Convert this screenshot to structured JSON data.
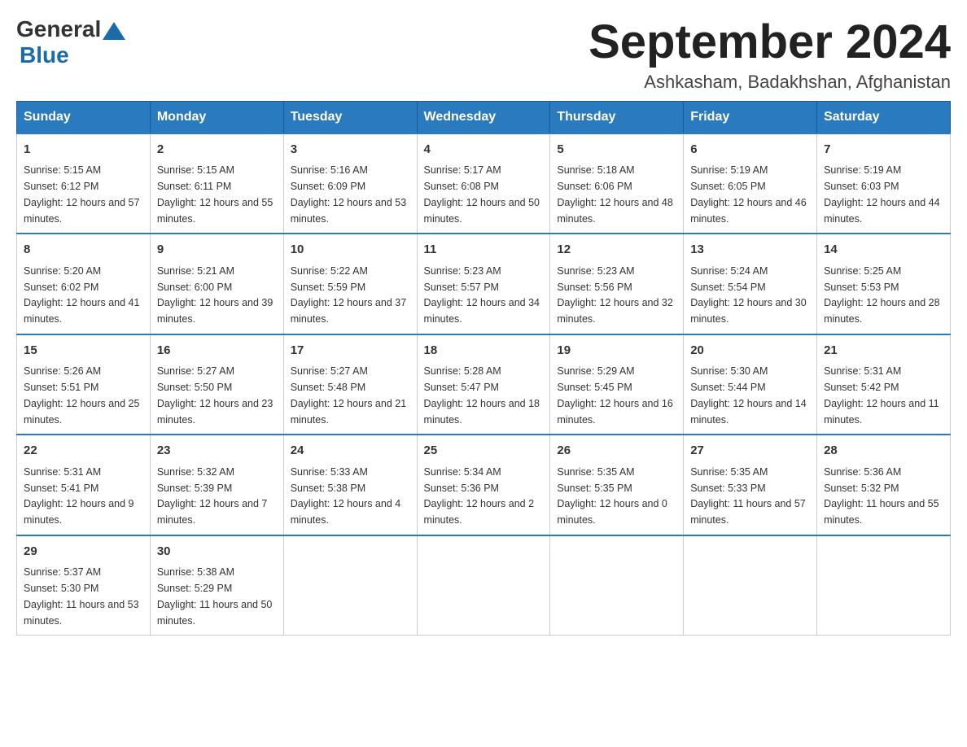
{
  "header": {
    "logo_general": "General",
    "logo_blue": "Blue",
    "month_title": "September 2024",
    "location": "Ashkasham, Badakhshan, Afghanistan"
  },
  "weekdays": [
    "Sunday",
    "Monday",
    "Tuesday",
    "Wednesday",
    "Thursday",
    "Friday",
    "Saturday"
  ],
  "weeks": [
    [
      {
        "day": "1",
        "sunrise": "5:15 AM",
        "sunset": "6:12 PM",
        "daylight": "12 hours and 57 minutes."
      },
      {
        "day": "2",
        "sunrise": "5:15 AM",
        "sunset": "6:11 PM",
        "daylight": "12 hours and 55 minutes."
      },
      {
        "day": "3",
        "sunrise": "5:16 AM",
        "sunset": "6:09 PM",
        "daylight": "12 hours and 53 minutes."
      },
      {
        "day": "4",
        "sunrise": "5:17 AM",
        "sunset": "6:08 PM",
        "daylight": "12 hours and 50 minutes."
      },
      {
        "day": "5",
        "sunrise": "5:18 AM",
        "sunset": "6:06 PM",
        "daylight": "12 hours and 48 minutes."
      },
      {
        "day": "6",
        "sunrise": "5:19 AM",
        "sunset": "6:05 PM",
        "daylight": "12 hours and 46 minutes."
      },
      {
        "day": "7",
        "sunrise": "5:19 AM",
        "sunset": "6:03 PM",
        "daylight": "12 hours and 44 minutes."
      }
    ],
    [
      {
        "day": "8",
        "sunrise": "5:20 AM",
        "sunset": "6:02 PM",
        "daylight": "12 hours and 41 minutes."
      },
      {
        "day": "9",
        "sunrise": "5:21 AM",
        "sunset": "6:00 PM",
        "daylight": "12 hours and 39 minutes."
      },
      {
        "day": "10",
        "sunrise": "5:22 AM",
        "sunset": "5:59 PM",
        "daylight": "12 hours and 37 minutes."
      },
      {
        "day": "11",
        "sunrise": "5:23 AM",
        "sunset": "5:57 PM",
        "daylight": "12 hours and 34 minutes."
      },
      {
        "day": "12",
        "sunrise": "5:23 AM",
        "sunset": "5:56 PM",
        "daylight": "12 hours and 32 minutes."
      },
      {
        "day": "13",
        "sunrise": "5:24 AM",
        "sunset": "5:54 PM",
        "daylight": "12 hours and 30 minutes."
      },
      {
        "day": "14",
        "sunrise": "5:25 AM",
        "sunset": "5:53 PM",
        "daylight": "12 hours and 28 minutes."
      }
    ],
    [
      {
        "day": "15",
        "sunrise": "5:26 AM",
        "sunset": "5:51 PM",
        "daylight": "12 hours and 25 minutes."
      },
      {
        "day": "16",
        "sunrise": "5:27 AM",
        "sunset": "5:50 PM",
        "daylight": "12 hours and 23 minutes."
      },
      {
        "day": "17",
        "sunrise": "5:27 AM",
        "sunset": "5:48 PM",
        "daylight": "12 hours and 21 minutes."
      },
      {
        "day": "18",
        "sunrise": "5:28 AM",
        "sunset": "5:47 PM",
        "daylight": "12 hours and 18 minutes."
      },
      {
        "day": "19",
        "sunrise": "5:29 AM",
        "sunset": "5:45 PM",
        "daylight": "12 hours and 16 minutes."
      },
      {
        "day": "20",
        "sunrise": "5:30 AM",
        "sunset": "5:44 PM",
        "daylight": "12 hours and 14 minutes."
      },
      {
        "day": "21",
        "sunrise": "5:31 AM",
        "sunset": "5:42 PM",
        "daylight": "12 hours and 11 minutes."
      }
    ],
    [
      {
        "day": "22",
        "sunrise": "5:31 AM",
        "sunset": "5:41 PM",
        "daylight": "12 hours and 9 minutes."
      },
      {
        "day": "23",
        "sunrise": "5:32 AM",
        "sunset": "5:39 PM",
        "daylight": "12 hours and 7 minutes."
      },
      {
        "day": "24",
        "sunrise": "5:33 AM",
        "sunset": "5:38 PM",
        "daylight": "12 hours and 4 minutes."
      },
      {
        "day": "25",
        "sunrise": "5:34 AM",
        "sunset": "5:36 PM",
        "daylight": "12 hours and 2 minutes."
      },
      {
        "day": "26",
        "sunrise": "5:35 AM",
        "sunset": "5:35 PM",
        "daylight": "12 hours and 0 minutes."
      },
      {
        "day": "27",
        "sunrise": "5:35 AM",
        "sunset": "5:33 PM",
        "daylight": "11 hours and 57 minutes."
      },
      {
        "day": "28",
        "sunrise": "5:36 AM",
        "sunset": "5:32 PM",
        "daylight": "11 hours and 55 minutes."
      }
    ],
    [
      {
        "day": "29",
        "sunrise": "5:37 AM",
        "sunset": "5:30 PM",
        "daylight": "11 hours and 53 minutes."
      },
      {
        "day": "30",
        "sunrise": "5:38 AM",
        "sunset": "5:29 PM",
        "daylight": "11 hours and 50 minutes."
      },
      null,
      null,
      null,
      null,
      null
    ]
  ]
}
